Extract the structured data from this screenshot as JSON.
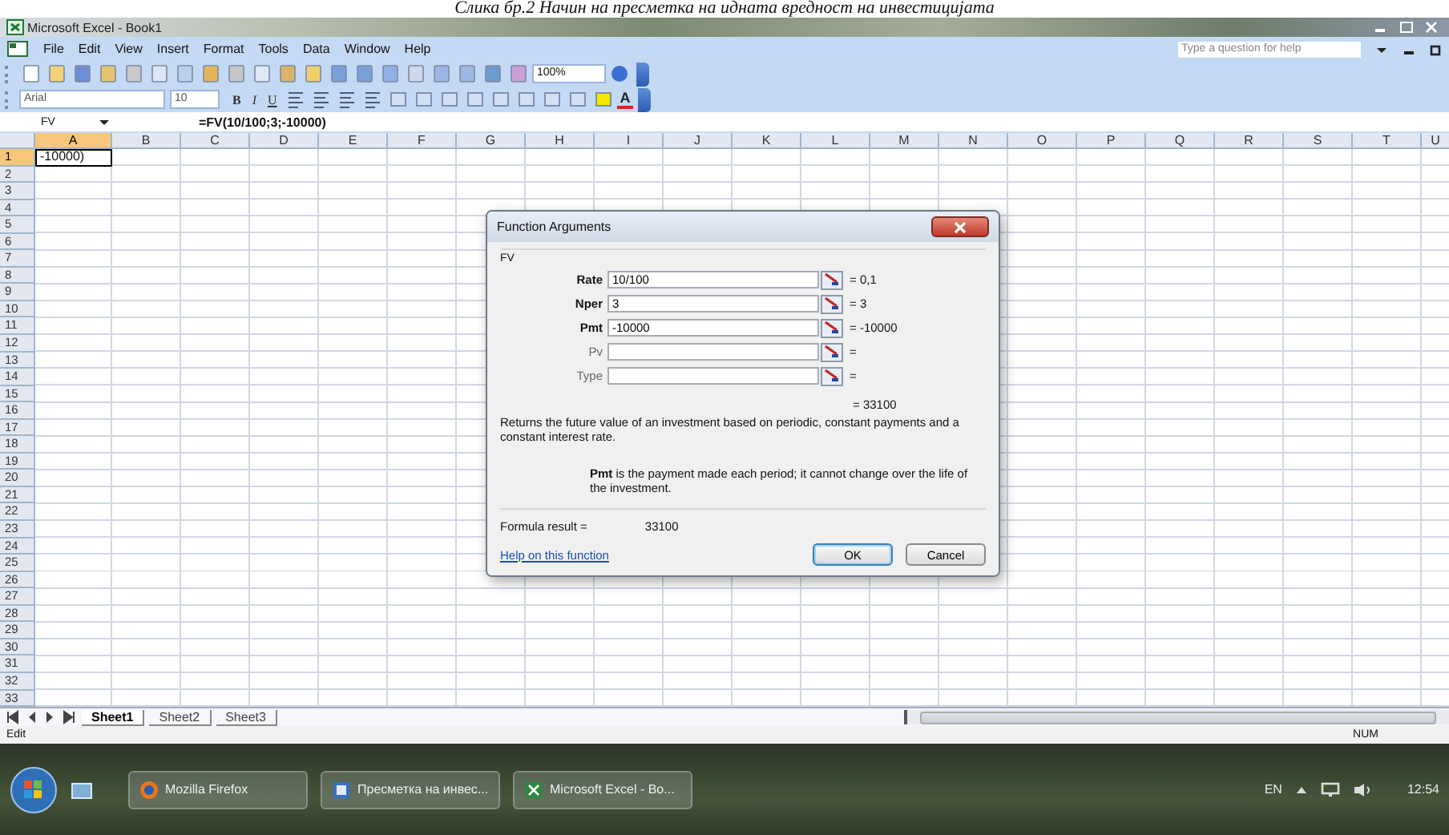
{
  "caption": "Слика бр.2 Начин на пресметка на идната вредност на инвестицијата",
  "window": {
    "title": "Microsoft Excel - Book1"
  },
  "menu": [
    "File",
    "Edit",
    "View",
    "Insert",
    "Format",
    "Tools",
    "Data",
    "Window",
    "Help"
  ],
  "help_box": {
    "placeholder": "Type a question for help"
  },
  "toolbar": {
    "zoom": "100%"
  },
  "format_toolbar": {
    "font": "Arial",
    "size": "10",
    "style_buttons": [
      "B",
      "I",
      "U"
    ],
    "font_color": "A"
  },
  "formula_bar": {
    "name_box": "FV",
    "formula": "=FV(10/100;3;-10000)"
  },
  "columns": [
    {
      "label": "A",
      "selected": true
    },
    {
      "label": "B",
      "selected": false
    },
    {
      "label": "C",
      "selected": false
    },
    {
      "label": "D",
      "selected": false
    },
    {
      "label": "E",
      "selected": false
    },
    {
      "label": "F",
      "selected": false
    },
    {
      "label": "G",
      "selected": false
    },
    {
      "label": "H",
      "selected": false
    },
    {
      "label": "I",
      "selected": false
    },
    {
      "label": "J",
      "selected": false
    },
    {
      "label": "K",
      "selected": false
    },
    {
      "label": "L",
      "selected": false
    },
    {
      "label": "M",
      "selected": false
    },
    {
      "label": "N",
      "selected": false
    },
    {
      "label": "O",
      "selected": false
    },
    {
      "label": "P",
      "selected": false
    },
    {
      "label": "Q",
      "selected": false
    },
    {
      "label": "R",
      "selected": false
    },
    {
      "label": "S",
      "selected": false
    },
    {
      "label": "T",
      "selected": false
    },
    {
      "label": "U",
      "selected": false
    }
  ],
  "rows": [
    {
      "label": "1",
      "selected": true
    },
    {
      "label": "2",
      "selected": false
    },
    {
      "label": "3",
      "selected": false
    },
    {
      "label": "4",
      "selected": false
    },
    {
      "label": "5",
      "selected": false
    },
    {
      "label": "6",
      "selected": false
    },
    {
      "label": "7",
      "selected": false
    },
    {
      "label": "8",
      "selected": false
    },
    {
      "label": "9",
      "selected": false
    },
    {
      "label": "10",
      "selected": false
    },
    {
      "label": "11",
      "selected": false
    },
    {
      "label": "12",
      "selected": false
    },
    {
      "label": "13",
      "selected": false
    },
    {
      "label": "14",
      "selected": false
    },
    {
      "label": "15",
      "selected": false
    },
    {
      "label": "16",
      "selected": false
    },
    {
      "label": "17",
      "selected": false
    },
    {
      "label": "18",
      "selected": false
    },
    {
      "label": "19",
      "selected": false
    },
    {
      "label": "20",
      "selected": false
    },
    {
      "label": "21",
      "selected": false
    },
    {
      "label": "22",
      "selected": false
    },
    {
      "label": "23",
      "selected": false
    },
    {
      "label": "24",
      "selected": false
    },
    {
      "label": "25",
      "selected": false
    },
    {
      "label": "26",
      "selected": false
    },
    {
      "label": "27",
      "selected": false
    },
    {
      "label": "28",
      "selected": false
    },
    {
      "label": "29",
      "selected": false
    },
    {
      "label": "30",
      "selected": false
    },
    {
      "label": "31",
      "selected": false
    },
    {
      "label": "32",
      "selected": false
    },
    {
      "label": "33",
      "selected": false
    }
  ],
  "active_cell": {
    "value": "-10000)"
  },
  "sheet_tabs": [
    {
      "label": "Sheet1",
      "selected": true
    },
    {
      "label": "Sheet2",
      "selected": false
    },
    {
      "label": "Sheet3",
      "selected": false
    }
  ],
  "status_bar": {
    "mode": "Edit",
    "indicator": "NUM"
  },
  "dialog": {
    "title": "Function Arguments",
    "function": "FV",
    "arguments": [
      {
        "name": "Rate",
        "required": true,
        "value": "10/100",
        "result": "= 0,1"
      },
      {
        "name": "Nper",
        "required": true,
        "value": "3",
        "result": "= 3"
      },
      {
        "name": "Pmt",
        "required": true,
        "value": "-10000",
        "result": "= -10000"
      },
      {
        "name": "Pv",
        "required": false,
        "result": "="
      },
      {
        "name": "Type",
        "required": false,
        "result": "="
      }
    ],
    "total": "= 33100",
    "description": "Returns the future value of an investment based on periodic, constant payments and a constant interest rate.",
    "argument_help": "**Pmt** is the payment made each period; it cannot change over the life of the investment.",
    "formula_result_label": "Formula result =",
    "formula_result": "33100",
    "help_link": "Help on this function",
    "buttons": [
      {
        "label": "OK",
        "default": true
      },
      {
        "label": "Cancel",
        "default": false
      }
    ]
  },
  "taskbar": {
    "items": [
      {
        "label": "Mozilla Firefox",
        "kind": "browser"
      },
      {
        "label": "Пресметка на инвес...",
        "kind": "document"
      },
      {
        "label": "Microsoft Excel - Bo...",
        "kind": "spreadsheet"
      }
    ],
    "language": "EN",
    "time": "12:54"
  }
}
